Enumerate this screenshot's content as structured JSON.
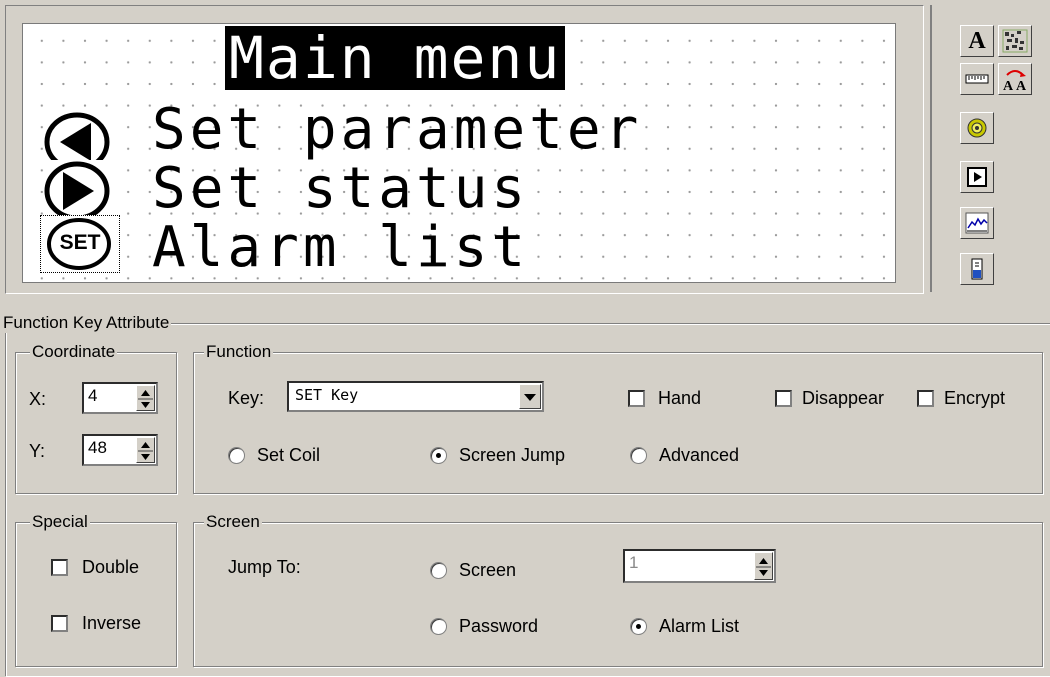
{
  "lcd": {
    "title": "Main menu",
    "rows": [
      "Set parameter",
      "Set status",
      "Alarm list"
    ],
    "key_icons": [
      "left-arrow-key-icon",
      "right-arrow-key-icon",
      "set-key-icon"
    ],
    "set_key_label": "SET"
  },
  "toolbar": {
    "text_button": "A",
    "tools": [
      "text-tool-icon",
      "bitmap-tool-icon",
      "ruler-tool-icon",
      "font-swap-icon",
      "lamp-tool-icon",
      "function-key-tool-icon",
      "trend-chart-tool-icon",
      "bar-tool-icon"
    ]
  },
  "panel": {
    "title": "Function Key Attribute",
    "coordinate": {
      "label": "Coordinate",
      "x_label": "X:",
      "x_value": "4",
      "y_label": "Y:",
      "y_value": "48"
    },
    "function": {
      "label": "Function",
      "key_label": "Key:",
      "key_value": "SET Key",
      "hand": "Hand",
      "hand_checked": false,
      "disappear": "Disappear",
      "disappear_checked": false,
      "encrypt": "Encrypt",
      "encrypt_checked": false,
      "set_coil": "Set Coil",
      "screen_jump": "Screen Jump",
      "advanced": "Advanced",
      "selected": "Screen Jump"
    },
    "special": {
      "label": "Special",
      "double": "Double",
      "double_checked": false,
      "inverse": "Inverse",
      "inverse_checked": false
    },
    "screen": {
      "label": "Screen",
      "jump_to": "Jump To:",
      "screen_option": "Screen",
      "screen_number": "1",
      "password_option": "Password",
      "alarm_list_option": "Alarm List",
      "selected": "Alarm List"
    }
  }
}
